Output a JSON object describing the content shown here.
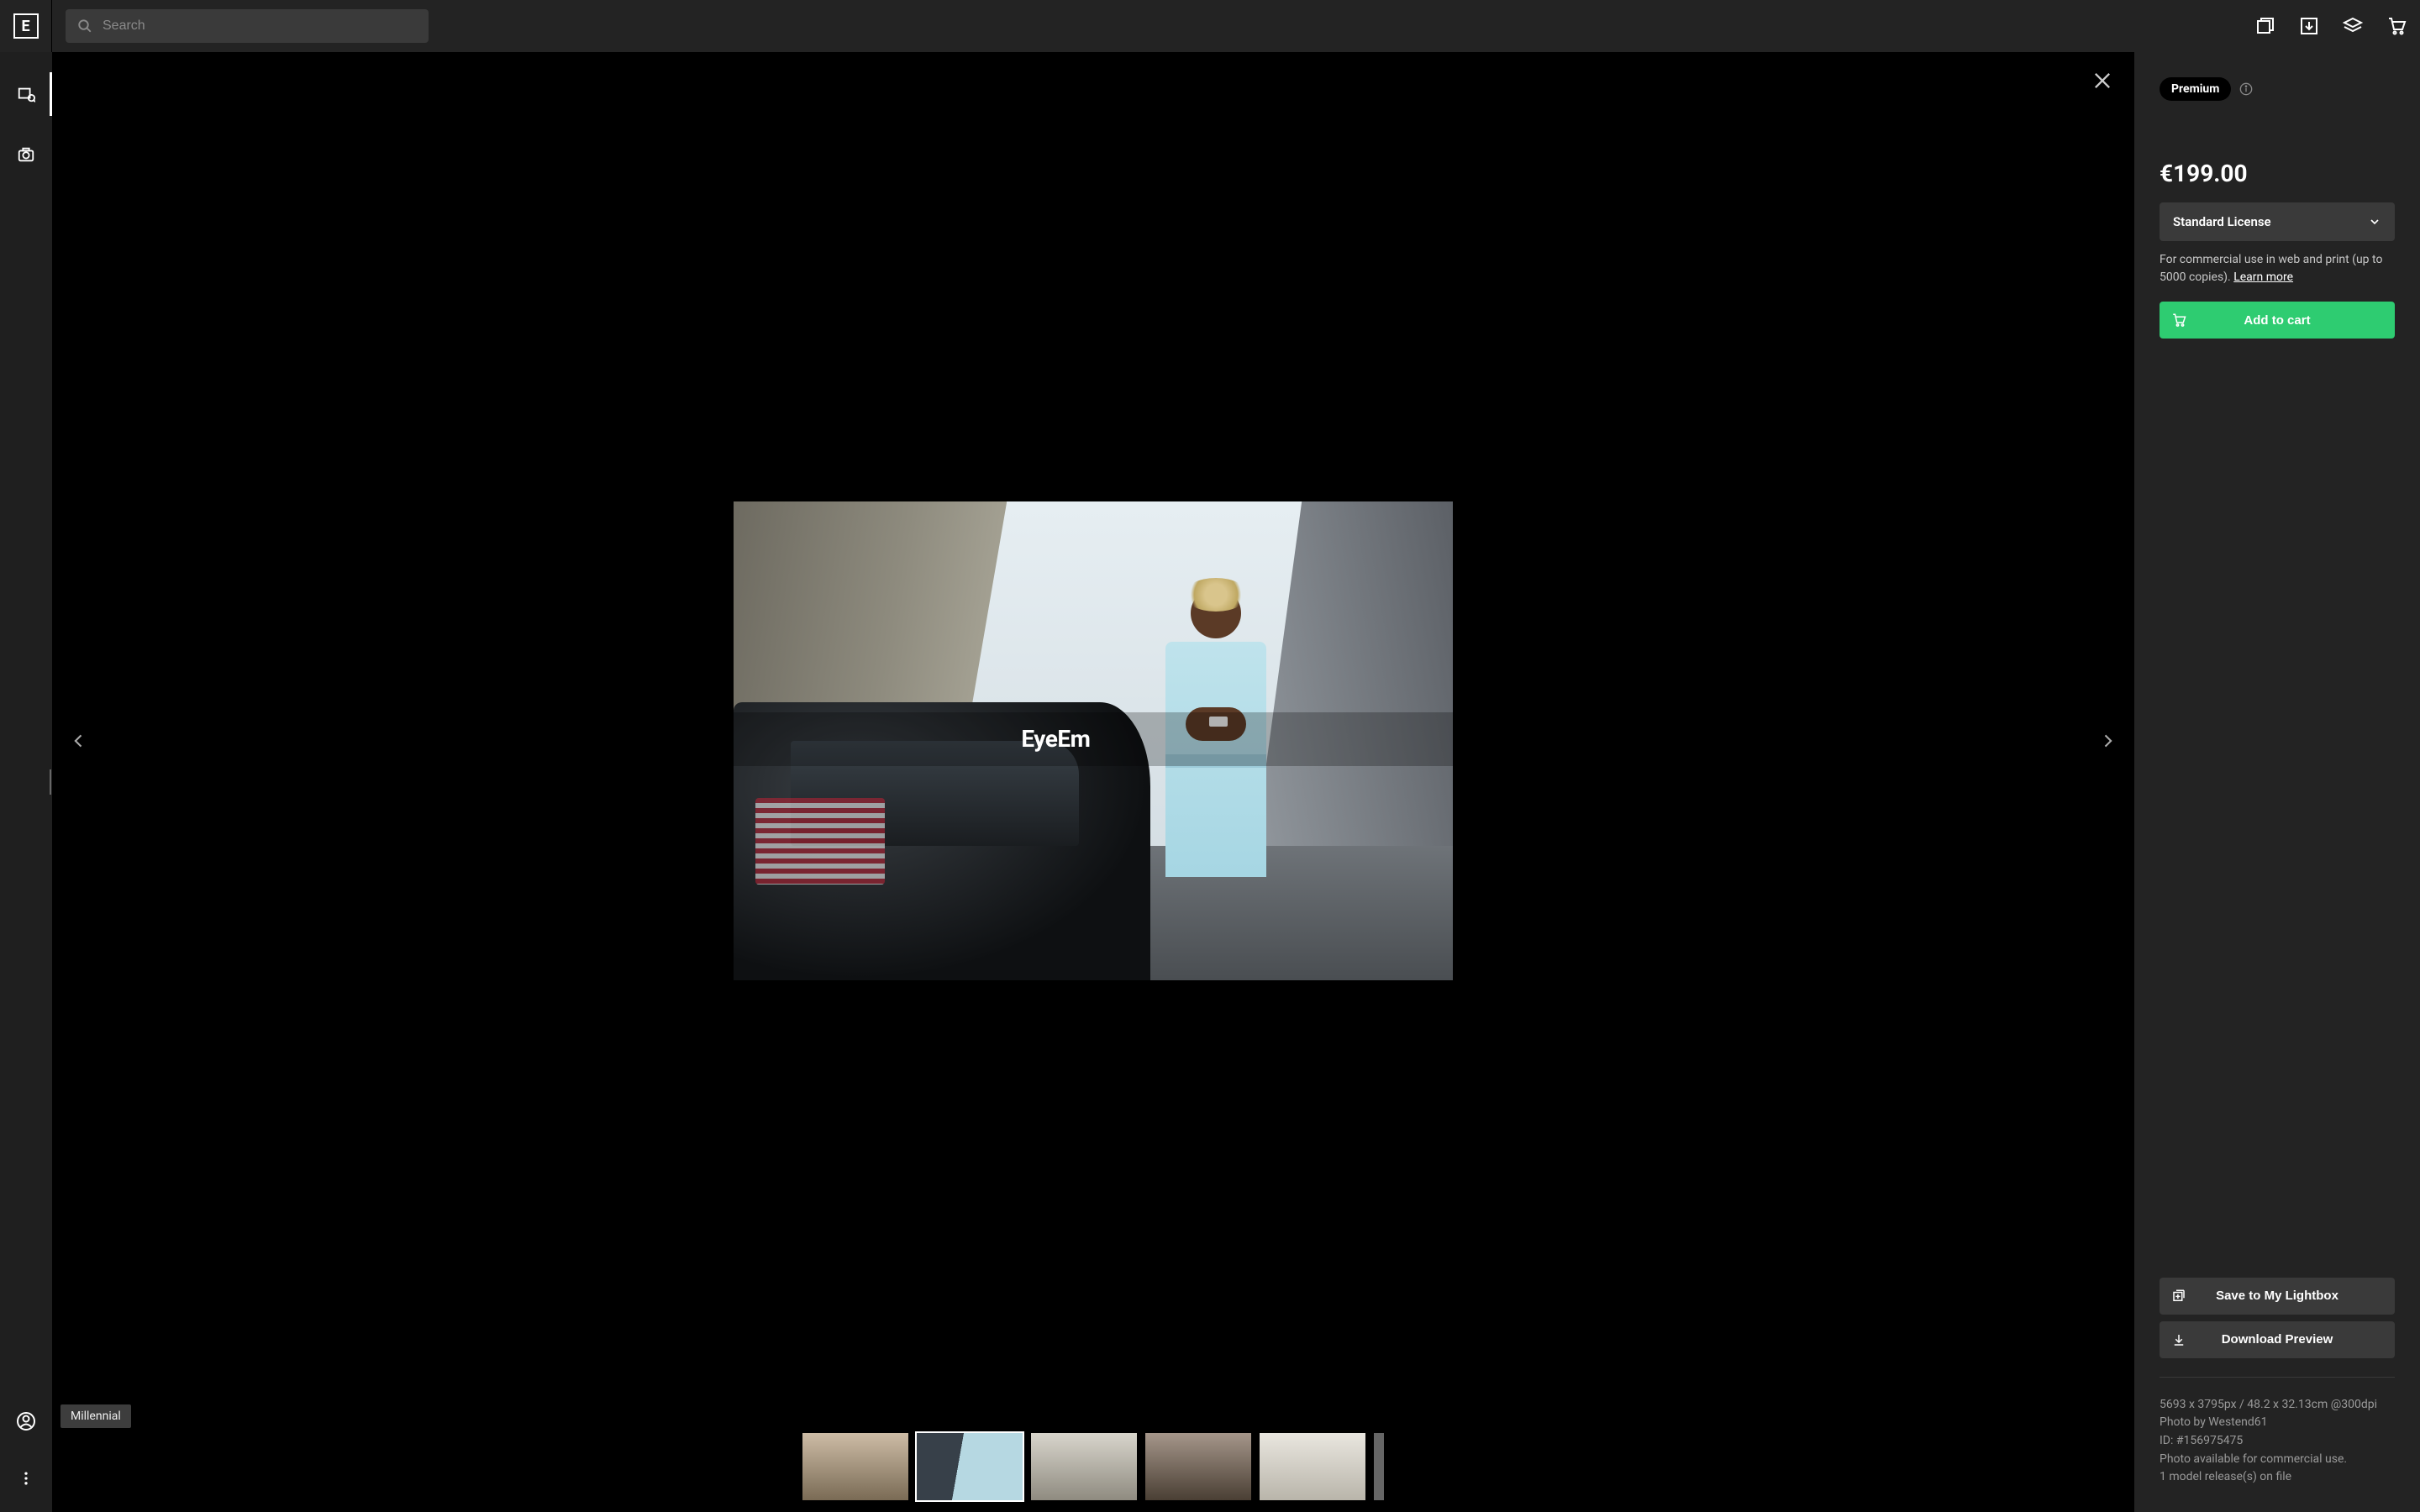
{
  "search": {
    "placeholder": "Search"
  },
  "watermark": "EyeEm",
  "tag": "Millennial",
  "panel": {
    "premium_label": "Premium",
    "price": "€199.00",
    "license_label": "Standard License",
    "license_desc": "For commercial use in web and print (up to 5000 copies). ",
    "learn_more": "Learn more",
    "add_to_cart": "Add to cart",
    "save_lightbox": "Save to My Lightbox",
    "download_preview": "Download Preview",
    "meta_dims": "5693 x 3795px / 48.2 x 32.13cm @300dpi",
    "meta_author": "Photo by Westend61",
    "meta_id": "ID: #156975475",
    "meta_avail": "Photo available for commercial use.",
    "meta_release": "1 model release(s) on file"
  }
}
